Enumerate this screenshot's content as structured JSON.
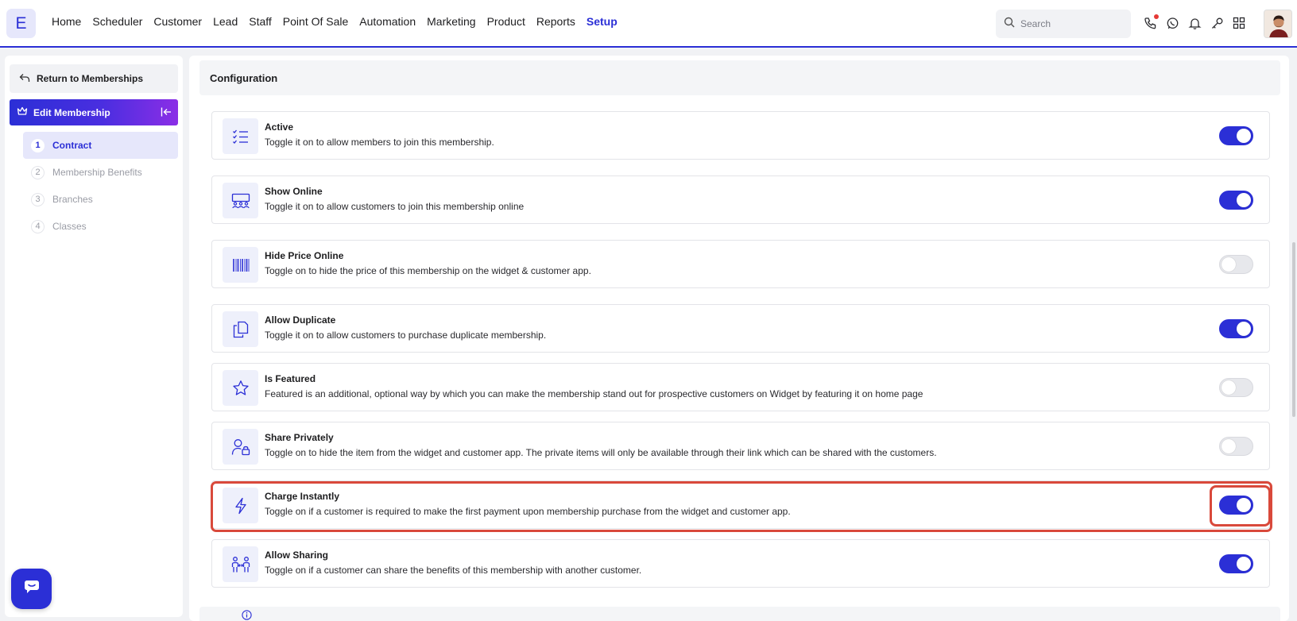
{
  "brand": {
    "logo_letter": "E",
    "accent": "#2b2fd6"
  },
  "nav": {
    "items": [
      "Home",
      "Scheduler",
      "Customer",
      "Lead",
      "Staff",
      "Point Of Sale",
      "Automation",
      "Marketing",
      "Product",
      "Reports",
      "Setup"
    ],
    "active": "Setup"
  },
  "search": {
    "placeholder": "Search"
  },
  "toolbar_icons": [
    "phone-icon",
    "whatsapp-icon",
    "bell-icon",
    "key-icon",
    "apps-grid-icon"
  ],
  "sidebar": {
    "return_label": "Return to Memberships",
    "section_label": "Edit Membership",
    "steps": [
      {
        "num": "1",
        "label": "Contract",
        "active": true
      },
      {
        "num": "2",
        "label": "Membership Benefits",
        "active": false
      },
      {
        "num": "3",
        "label": "Branches",
        "active": false
      },
      {
        "num": "4",
        "label": "Classes",
        "active": false
      }
    ]
  },
  "main": {
    "section_title": "Configuration",
    "settings": [
      {
        "icon": "checklist-icon",
        "title": "Active",
        "description": "Toggle it on to allow members to join this membership.",
        "enabled": true
      },
      {
        "icon": "audience-icon",
        "title": "Show Online",
        "description": "Toggle it on to allow customers to join this membership online",
        "enabled": true
      },
      {
        "icon": "barcode-icon",
        "title": "Hide Price Online",
        "description": "Toggle on to hide the price of this membership on the widget & customer app.",
        "enabled": false
      },
      {
        "icon": "copy-icon",
        "title": "Allow Duplicate",
        "description": "Toggle it on to allow customers to purchase duplicate membership.",
        "enabled": true
      },
      {
        "icon": "star-icon",
        "title": "Is Featured",
        "description": "Featured is an additional, optional way by which you can make the membership stand out for prospective customers on Widget by featuring it on home page",
        "enabled": false
      },
      {
        "icon": "user-lock-icon",
        "title": "Share Privately",
        "description": "Toggle on to hide the item from the widget and customer app. The private items will only be available through their link which can be shared with the customers.",
        "enabled": false
      },
      {
        "icon": "lightning-icon",
        "title": "Charge Instantly",
        "description": "Toggle on if a customer is required to make the first payment upon membership purchase from the widget and customer app.",
        "enabled": true,
        "highlighted": true
      },
      {
        "icon": "sharing-users-icon",
        "title": "Allow Sharing",
        "description": "Toggle on if a customer can share the benefits of this membership with another customer.",
        "enabled": true
      }
    ]
  },
  "colors": {
    "toggle_on": "#2b2fd6",
    "toggle_off": "#e7e8ec",
    "highlight": "#d9493b"
  }
}
